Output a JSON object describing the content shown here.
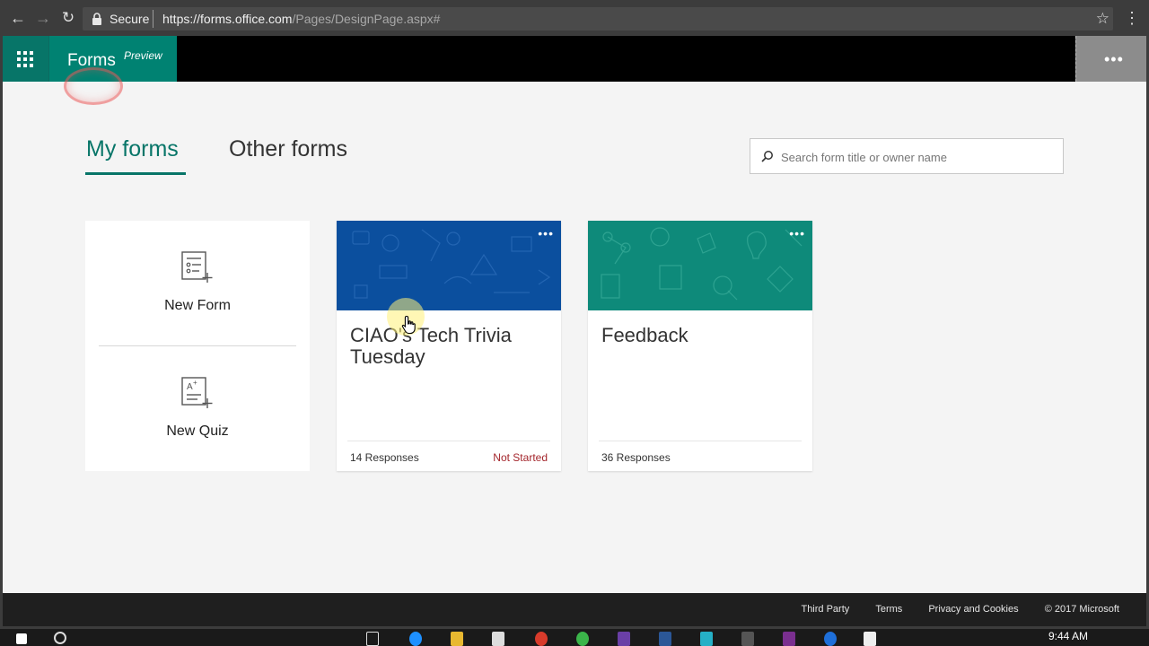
{
  "browser": {
    "secure_label": "Secure",
    "url_host": "https://forms.office.com",
    "url_path": "/Pages/DesignPage.aspx#"
  },
  "app": {
    "name": "Forms",
    "badge": "Preview"
  },
  "tabs": [
    {
      "label": "My forms",
      "active": true
    },
    {
      "label": "Other forms",
      "active": false
    }
  ],
  "search": {
    "placeholder": "Search form title or owner name"
  },
  "new_card": {
    "new_form_label": "New Form",
    "new_quiz_label": "New Quiz"
  },
  "forms": [
    {
      "title": "CIAO's Tech Trivia Tuesday",
      "responses": "14 Responses",
      "status": "Not Started",
      "banner_color": "#0b4f9e"
    },
    {
      "title": "Feedback",
      "responses": "36 Responses",
      "status": "",
      "banner_color": "#0e8a7a"
    }
  ],
  "footer": {
    "links": [
      "Third Party",
      "Terms",
      "Privacy and Cookies",
      "© 2017 Microsoft"
    ]
  },
  "taskbar": {
    "time": "9:44 AM"
  },
  "colors": {
    "accent": "#077568",
    "brand_block": "#008272",
    "status_not_started": "#a4262c"
  }
}
